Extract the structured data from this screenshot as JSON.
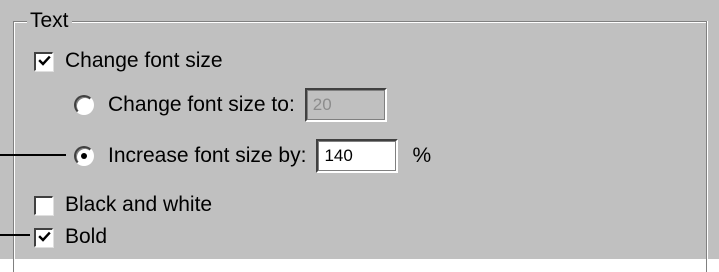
{
  "group": {
    "title": "Text"
  },
  "options": {
    "change_font_size": {
      "label": "Change font size",
      "checked": true
    },
    "change_font_size_to": {
      "label": "Change font size to:",
      "value": "20",
      "selected": false,
      "enabled": false
    },
    "increase_font_size_by": {
      "label": "Increase font size by:",
      "value": "140",
      "unit": "%",
      "selected": true
    },
    "black_and_white": {
      "label": "Black and white",
      "checked": false
    },
    "bold": {
      "label": "Bold",
      "checked": true
    }
  },
  "colors": {
    "panel": "#c0c0c0",
    "disabled_text": "#8c8c8c"
  }
}
